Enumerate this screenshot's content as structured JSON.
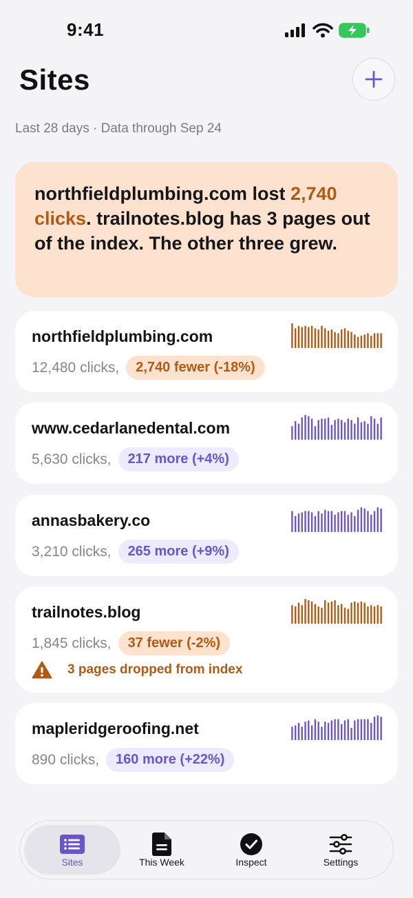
{
  "status": {
    "time": "9:41"
  },
  "header": {
    "title": "Sites",
    "add_label": "+"
  },
  "subtitle": "Last 28 days · Data through Sep 24",
  "summary": {
    "part1": "northfieldplumbing.com lost ",
    "highlight": "2,740 clicks",
    "part2": ". trailnotes.blog has 3 pages out of the index. The other three grew."
  },
  "sites": [
    {
      "name": "northfieldplumbing.com",
      "clicks": "12,480 clicks,",
      "change": "2,740 fewer (-18%)",
      "trend": "down",
      "spark": [
        1.0,
        0.8,
        0.9,
        0.85,
        0.9,
        0.85,
        0.9,
        0.8,
        0.75,
        0.9,
        0.8,
        0.7,
        0.75,
        0.65,
        0.6,
        0.75,
        0.8,
        0.7,
        0.65,
        0.55,
        0.45,
        0.5,
        0.55,
        0.6,
        0.5,
        0.6,
        0.6,
        0.6
      ]
    },
    {
      "name": "www.cedarlanedental.com",
      "clicks": "5,630 clicks,",
      "change": "217 more (+4%)",
      "trend": "up",
      "spark": [
        0.55,
        0.75,
        0.65,
        0.9,
        1.0,
        0.95,
        0.85,
        0.55,
        0.8,
        0.85,
        0.85,
        0.9,
        0.6,
        0.8,
        0.85,
        0.8,
        0.7,
        0.85,
        0.8,
        0.65,
        0.9,
        0.7,
        0.75,
        0.65,
        0.95,
        0.85,
        0.65,
        0.9
      ]
    },
    {
      "name": "annasbakery.co",
      "clicks": "3,210 clicks,",
      "change": "265 more (+9%)",
      "trend": "up",
      "spark": [
        0.85,
        0.65,
        0.75,
        0.8,
        0.85,
        0.85,
        0.8,
        0.65,
        0.85,
        0.75,
        0.9,
        0.85,
        0.85,
        0.7,
        0.8,
        0.85,
        0.85,
        0.7,
        0.8,
        0.65,
        0.9,
        1.0,
        0.95,
        0.85,
        0.7,
        0.85,
        1.0,
        0.95
      ]
    },
    {
      "name": "trailnotes.blog",
      "clicks": "1,845 clicks,",
      "change": "37 fewer (-2%)",
      "trend": "down",
      "spark": [
        0.75,
        0.7,
        0.85,
        0.75,
        1.0,
        0.95,
        0.9,
        0.8,
        0.7,
        0.65,
        0.95,
        0.85,
        0.9,
        0.95,
        0.75,
        0.8,
        0.65,
        0.6,
        0.85,
        0.9,
        0.85,
        0.9,
        0.85,
        0.7,
        0.75,
        0.7,
        0.75,
        0.7
      ]
    },
    {
      "name": "mapleridgeroofing.net",
      "clicks": "890 clicks,",
      "change": "160 more (+22%)",
      "trend": "up",
      "spark": [
        0.55,
        0.6,
        0.7,
        0.55,
        0.75,
        0.8,
        0.6,
        0.85,
        0.75,
        0.55,
        0.75,
        0.7,
        0.8,
        0.85,
        0.85,
        0.65,
        0.8,
        0.85,
        0.5,
        0.8,
        0.85,
        0.85,
        0.85,
        0.85,
        0.7,
        0.95,
        1.0,
        0.95
      ]
    }
  ],
  "warning": {
    "text": "3 pages dropped from index"
  },
  "tabs": [
    {
      "label": "Sites",
      "icon": "list-icon",
      "active": true
    },
    {
      "label": "This Week",
      "icon": "document-icon",
      "active": false
    },
    {
      "label": "Inspect",
      "icon": "check-circle-icon",
      "active": false
    },
    {
      "label": "Settings",
      "icon": "sliders-icon",
      "active": false
    }
  ],
  "colors": {
    "accent": "#6a55c9",
    "down": "#b05a14",
    "down_bg": "#fde3cf",
    "up_bg": "#ecebfd",
    "battery": "#34c759"
  }
}
